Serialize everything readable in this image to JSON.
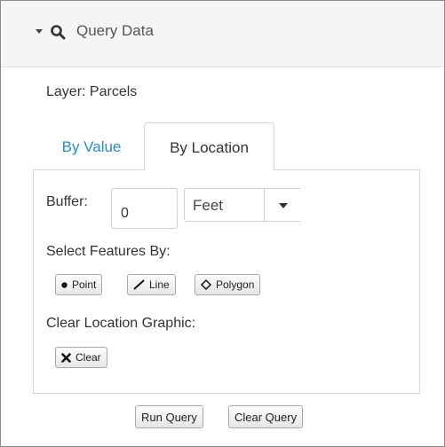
{
  "header": {
    "title": "Query Data"
  },
  "layer": {
    "label": "Layer: Parcels"
  },
  "tabs": [
    {
      "label": "By Value",
      "active": false
    },
    {
      "label": "By Location",
      "active": true
    }
  ],
  "buffer": {
    "label": "Buffer:",
    "value": "0",
    "units": "Feet"
  },
  "select_features": {
    "label": "Select Features By:",
    "buttons": [
      {
        "label": "Point",
        "icon": "point-icon"
      },
      {
        "label": "Line",
        "icon": "line-icon"
      },
      {
        "label": "Polygon",
        "icon": "polygon-icon"
      }
    ]
  },
  "clear_graphic": {
    "label": "Clear Location Graphic:",
    "button": "Clear"
  },
  "footer": {
    "run": "Run Query",
    "clear": "Clear Query"
  },
  "colors": {
    "link": "#2a8bc5",
    "header_bg": "#f5f5f5",
    "border": "#d6d6d6"
  }
}
